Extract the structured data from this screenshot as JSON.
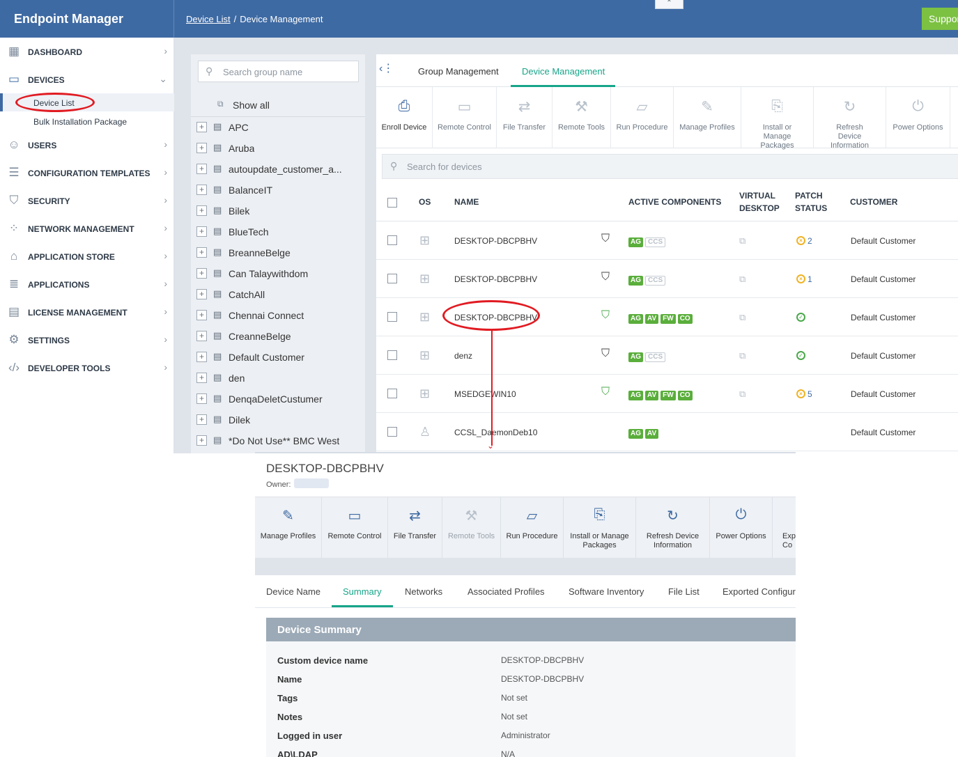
{
  "header": {
    "brand": "Endpoint Manager",
    "breadcrumb_link": "Device List",
    "breadcrumb_sep": "/",
    "breadcrumb_current": "Device Management",
    "collapse_glyph": "⌃",
    "support_label": "Support"
  },
  "sidebar": {
    "items": [
      {
        "label": "DASHBOARD",
        "icon": "dashboard-icon"
      },
      {
        "label": "DEVICES",
        "icon": "devices-icon"
      },
      {
        "label": "USERS",
        "icon": "user-icon"
      },
      {
        "label": "CONFIGURATION TEMPLATES",
        "icon": "templates-icon"
      },
      {
        "label": "SECURITY",
        "icon": "shield-icon"
      },
      {
        "label": "NETWORK MANAGEMENT",
        "icon": "network-icon"
      },
      {
        "label": "APPLICATION STORE",
        "icon": "store-icon"
      },
      {
        "label": "APPLICATIONS",
        "icon": "applications-icon"
      },
      {
        "label": "LICENSE MANAGEMENT",
        "icon": "license-icon"
      },
      {
        "label": "SETTINGS",
        "icon": "gear-icon"
      },
      {
        "label": "DEVELOPER TOOLS",
        "icon": "code-icon"
      }
    ],
    "sub_items": [
      {
        "label": "Device List"
      },
      {
        "label": "Bulk Installation Package"
      }
    ]
  },
  "groups": {
    "search_placeholder": "Search group name",
    "show_all": "Show all",
    "items": [
      "APC",
      "Aruba",
      "autoupdate_customer_a...",
      "BalanceIT",
      "Bilek",
      "BlueTech",
      "BreanneBelge",
      "Can Talaywithdom",
      "CatchAll",
      "Chennai Connect",
      "CreanneBelge",
      "Default Customer",
      "den",
      "DenqaDeletCustumer",
      "Dilek",
      "*Do Not Use** BMC West"
    ]
  },
  "main": {
    "tabs": [
      {
        "label": "Group Management"
      },
      {
        "label": "Device Management"
      }
    ],
    "toolbar": [
      {
        "label": "Enroll Device",
        "icon": "enroll-device-icon"
      },
      {
        "label": "Remote Control",
        "icon": "laptop-icon"
      },
      {
        "label": "File Transfer",
        "icon": "file-transfer-icon"
      },
      {
        "label": "Remote Tools",
        "icon": "remote-tools-icon"
      },
      {
        "label": "Run Procedure",
        "icon": "run-procedure-icon"
      },
      {
        "label": "Manage Profiles",
        "icon": "profiles-icon"
      },
      {
        "label": "Install or Manage Packages",
        "icon": "package-icon"
      },
      {
        "label": "Refresh Device Information",
        "icon": "refresh-icon"
      },
      {
        "label": "Power Options",
        "icon": "power-icon"
      }
    ],
    "search_placeholder": "Search for devices",
    "columns": {
      "os": "OS",
      "name": "NAME",
      "active_components": "ACTIVE COMPONENTS",
      "virtual_desktop_1": "VIRTUAL",
      "virtual_desktop_2": "DESKTOP",
      "patch_status_1": "PATCH",
      "patch_status_2": "STATUS",
      "customer": "CUSTOMER"
    },
    "rows": [
      {
        "os": "windows-icon",
        "name": "DESKTOP-DBCPBHV",
        "shield": "shield-icon",
        "badges": [
          "AG",
          "CCS"
        ],
        "patch": "warning",
        "patch_count": "2",
        "customer": "Default Customer"
      },
      {
        "os": "windows-icon",
        "name": "DESKTOP-DBCPBHV",
        "shield": "shield-icon",
        "badges": [
          "AG",
          "CCS"
        ],
        "patch": "warning",
        "patch_count": "1",
        "customer": "Default Customer"
      },
      {
        "os": "windows-icon",
        "name": "DESKTOP-DBCPBHV",
        "shield": "shield-green-icon",
        "badges": [
          "AG",
          "AV",
          "FW",
          "CO"
        ],
        "patch": "ok",
        "patch_count": "",
        "customer": "Default Customer"
      },
      {
        "os": "windows-icon",
        "name": "denz",
        "shield": "shield-icon",
        "badges": [
          "AG",
          "CCS"
        ],
        "patch": "ok",
        "patch_count": "",
        "customer": "Default Customer"
      },
      {
        "os": "windows-icon",
        "name": "MSEDGEWIN10",
        "shield": "shield-green-icon",
        "badges": [
          "AG",
          "AV",
          "FW",
          "CO"
        ],
        "patch": "warning",
        "patch_count": "5",
        "customer": "Default Customer"
      },
      {
        "os": "linux-icon",
        "name": "CCSL_DaemonDeb10",
        "shield": "",
        "badges": [
          "AG",
          "AV"
        ],
        "patch": "",
        "patch_count": "",
        "customer": "Default Customer"
      }
    ]
  },
  "detail": {
    "title": "DESKTOP-DBCPBHV",
    "owner_label": "Owner:",
    "toolbar": [
      {
        "label": "Manage Profiles",
        "icon": "profiles-icon"
      },
      {
        "label": "Remote Control",
        "icon": "laptop-icon"
      },
      {
        "label": "File Transfer",
        "icon": "file-transfer-icon"
      },
      {
        "label": "Remote Tools",
        "icon": "remote-tools-icon"
      },
      {
        "label": "Run Procedure",
        "icon": "run-procedure-icon"
      },
      {
        "label": "Install or Manage Packages",
        "icon": "package-icon"
      },
      {
        "label": "Refresh Device Information",
        "icon": "refresh-icon"
      },
      {
        "label": "Power Options",
        "icon": "power-icon"
      },
      {
        "label": "Exp Co",
        "icon": "export-icon"
      }
    ],
    "tabs": [
      "Device Name",
      "Summary",
      "Networks",
      "Associated Profiles",
      "Software Inventory",
      "File List",
      "Exported Configur"
    ],
    "summary_title": "Device Summary",
    "summary_rows": [
      {
        "key": "Custom device name",
        "value": "DESKTOP-DBCPBHV"
      },
      {
        "key": "Name",
        "value": "DESKTOP-DBCPBHV"
      },
      {
        "key": "Tags",
        "value": "Not set"
      },
      {
        "key": "Notes",
        "value": "Not set"
      },
      {
        "key": "Logged in user",
        "value": "Administrator"
      },
      {
        "key": "AD\\LDAP",
        "value": "N/A"
      }
    ]
  },
  "colors": {
    "header_blue": "#3e6aa3",
    "accent_green": "#17a589",
    "badge_green": "#5aae3b",
    "support_green": "#7cc142",
    "annotation_red": "#e11b22"
  }
}
